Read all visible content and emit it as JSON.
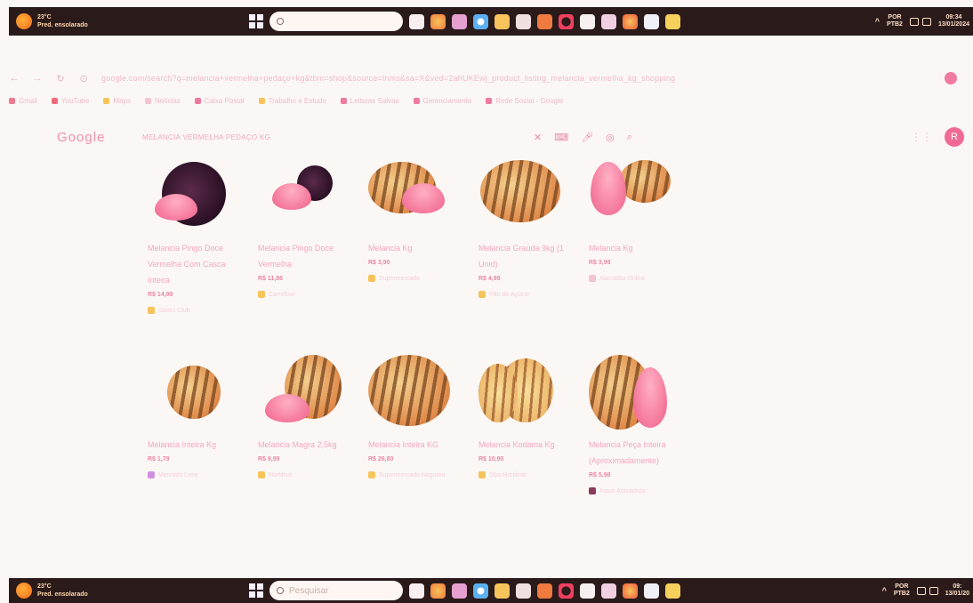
{
  "taskbar_top": {
    "weather_temp": "23°C",
    "weather_desc": "Pred. ensolarado",
    "search_placeholder": "",
    "lang_top": "POR",
    "lang_bottom": "PTB2",
    "time": "09:34",
    "date": "13/01/2024"
  },
  "taskbar_bottom": {
    "weather_temp": "23°C",
    "weather_desc": "Pred. ensolarado",
    "search_placeholder": "Pesquisar",
    "lang_top": "POR",
    "lang_bottom": "PTB2",
    "time": "09:",
    "date": "13/01/20"
  },
  "browser": {
    "url": "google.com/search?q=melancia+vermelha+pedaço+kg&tbm=shop&source=lnms&sa=X&ved=2ahUKEwj_product_listing_melancia_vermelha_kg_shopping"
  },
  "bookmarks": [
    {
      "label": "Gmail",
      "color": "#f07a90"
    },
    {
      "label": "YouTube",
      "color": "#f06a7a"
    },
    {
      "label": "Maps",
      "color": "#f6c45a"
    },
    {
      "label": "Notícias",
      "color": "#f2c4d0"
    },
    {
      "label": "Caixa Postal",
      "color": "#f07aa0"
    },
    {
      "label": "Trabalho e Estudo",
      "color": "#f6c45a"
    },
    {
      "label": "Leituras Salvas",
      "color": "#f07aa0"
    },
    {
      "label": "Gerenciamento",
      "color": "#f07aa0"
    },
    {
      "label": "Rede Social - Google",
      "color": "#f07aa0"
    }
  ],
  "google": {
    "logo": "Google",
    "query": "MELANCIA VERMELHA PEDAÇO KG",
    "avatar": "R"
  },
  "products": [
    {
      "title": "Melancia Pingo Doce Vermelha Com Casca Inteira",
      "price": "R$ 14,99",
      "merchant": "Sam's Club",
      "merchant_color": "#f6c45a",
      "thumb": "dark"
    },
    {
      "title": "Melancia Pingo Doce Vermelha",
      "price": "R$ 11,86",
      "merchant": "Carrefour",
      "merchant_color": "#f6c45a",
      "thumb": "dark-half"
    },
    {
      "title": "Melancia Kg",
      "price": "R$ 3,90",
      "merchant": "Supermercado",
      "merchant_color": "#f6c45a",
      "thumb": "stripe"
    },
    {
      "title": "Melancia Graúda 9kg (1 Unid)",
      "price": "R$ 4,99",
      "merchant": "Pão de Açúcar",
      "merchant_color": "#f6c45a",
      "thumb": "big"
    },
    {
      "title": "Melancia Kg",
      "price": "R$ 3,99",
      "merchant": "Atacadão Online",
      "merchant_color": "#f2c4d0",
      "thumb": "slice-pair"
    },
    {
      "title": "Melancia Inteira Kg",
      "price": "R$ 1,79",
      "merchant": "Mercado Livre",
      "merchant_color": "#d090e0",
      "thumb": "small"
    },
    {
      "title": "Melancia Magra 2,5kg",
      "price": "R$ 9,99",
      "merchant": "Hortifruti",
      "merchant_color": "#f6c45a",
      "thumb": "round-slice"
    },
    {
      "title": "Melancia Inteira KG",
      "price": "R$ 26,80",
      "merchant": "Supermercado Nagumo",
      "merchant_color": "#f6c45a",
      "thumb": "wide"
    },
    {
      "title": "Melancia Kodama Kg",
      "price": "R$ 10,90",
      "merchant": "Oba Hortifruti",
      "merchant_color": "#f6c45a",
      "thumb": "yellow"
    },
    {
      "title": "Melancia Peça Inteira (Aproximadamente)",
      "price": "R$ 5,98",
      "merchant": "Assaí Atacadista",
      "merchant_color": "#8a3a5a",
      "thumb": "cut"
    }
  ]
}
